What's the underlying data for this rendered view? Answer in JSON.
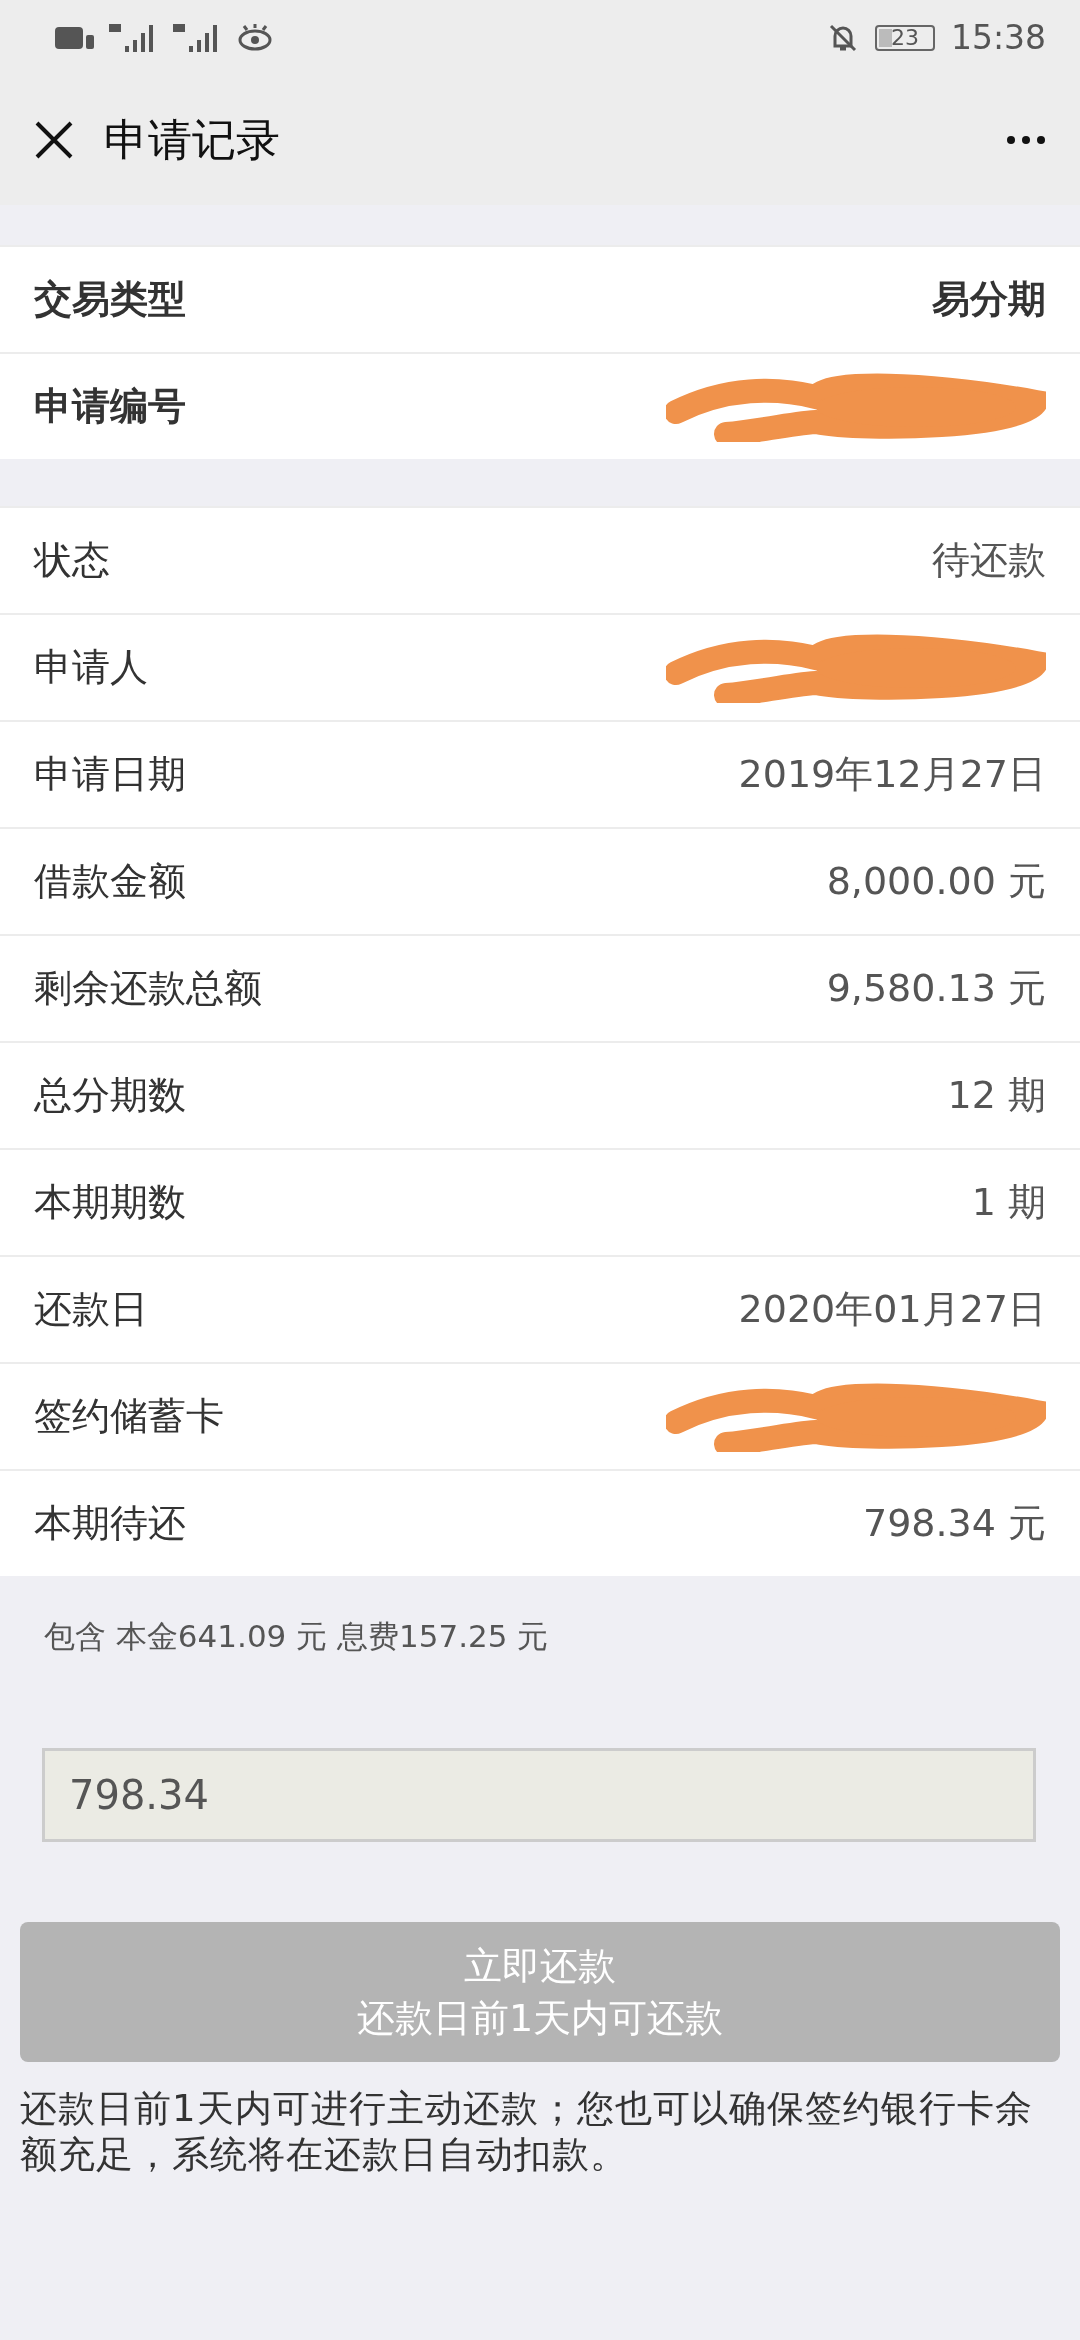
{
  "status_bar": {
    "time": "15:38",
    "battery": "23"
  },
  "header": {
    "title": "申请记录"
  },
  "summary": [
    {
      "label": "交易类型",
      "value": "易分期",
      "redacted": false
    },
    {
      "label": "申请编号",
      "redacted": true
    }
  ],
  "details": [
    {
      "label": "状态",
      "value": "待还款",
      "redacted": false
    },
    {
      "label": "申请人",
      "redacted": true
    },
    {
      "label": "申请日期",
      "value": "2019年12月27日",
      "redacted": false
    },
    {
      "label": "借款金额",
      "value": "8,000.00 元",
      "redacted": false
    },
    {
      "label": "剩余还款总额",
      "value": "9,580.13 元",
      "redacted": false
    },
    {
      "label": "总分期数",
      "value": "12 期",
      "redacted": false
    },
    {
      "label": "本期期数",
      "value": "1 期",
      "redacted": false
    },
    {
      "label": "还款日",
      "value": "2020年01月27日",
      "redacted": false
    },
    {
      "label": "签约储蓄卡",
      "redacted": true
    },
    {
      "label": "本期待还",
      "value": "798.34 元",
      "redacted": false
    }
  ],
  "breakdown": "包含 本金641.09 元 息费157.25 元",
  "amount_field": {
    "value": "798.34"
  },
  "repay_button": {
    "label": "立即还款",
    "sublabel": "还款日前1天内可还款",
    "disabled": true
  },
  "notice": "还款日前1天内可进行主动还款；您也可以确保签约银行卡余额充足，系统将在还款日自动扣款。"
}
